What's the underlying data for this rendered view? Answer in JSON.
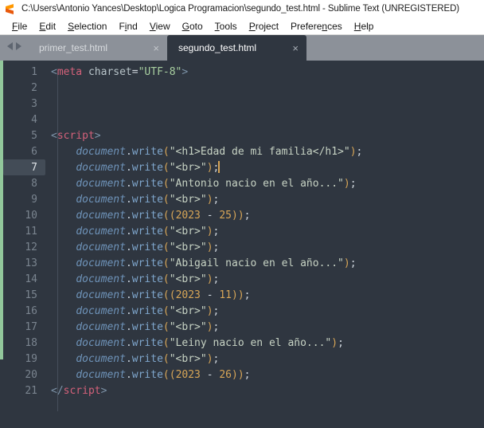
{
  "window": {
    "title": "C:\\Users\\Antonio Yances\\Desktop\\Logica Programacion\\segundo_test.html - Sublime Text (UNREGISTERED)",
    "icon": "sublime-text-icon"
  },
  "menubar": {
    "items": [
      {
        "label": "File",
        "accel": "F"
      },
      {
        "label": "Edit",
        "accel": "E"
      },
      {
        "label": "Selection",
        "accel": "S"
      },
      {
        "label": "Find",
        "accel": "i"
      },
      {
        "label": "View",
        "accel": "V"
      },
      {
        "label": "Goto",
        "accel": "G"
      },
      {
        "label": "Tools",
        "accel": "T"
      },
      {
        "label": "Project",
        "accel": "P"
      },
      {
        "label": "Preferences",
        "accel": "n"
      },
      {
        "label": "Help",
        "accel": "H"
      }
    ]
  },
  "tabbar": {
    "nav_prev_icon": "triangle-left-icon",
    "nav_next_icon": "triangle-right-icon",
    "tabs": [
      {
        "label": "primer_test.html",
        "active": false,
        "close_glyph": "×"
      },
      {
        "label": "segundo_test.html",
        "active": true,
        "close_glyph": "×"
      }
    ]
  },
  "editor": {
    "active_line": 7,
    "cursor_line": 7,
    "cursor_column": 31,
    "lines": [
      {
        "n": "1",
        "text": "<meta charset=\"UTF-8\">"
      },
      {
        "n": "2",
        "text": ""
      },
      {
        "n": "3",
        "text": ""
      },
      {
        "n": "4",
        "text": ""
      },
      {
        "n": "5",
        "text": "<script>"
      },
      {
        "n": "6",
        "text": "    document.write(\"<h1>Edad de mi familia</h1>\");"
      },
      {
        "n": "7",
        "text": "    document.write(\"<br>\");"
      },
      {
        "n": "8",
        "text": "    document.write(\"Antonio nacio en el año...\");"
      },
      {
        "n": "9",
        "text": "    document.write(\"<br>\");"
      },
      {
        "n": "10",
        "text": "    document.write((2023 - 25));"
      },
      {
        "n": "11",
        "text": "    document.write(\"<br>\");"
      },
      {
        "n": "12",
        "text": "    document.write(\"<br>\");"
      },
      {
        "n": "13",
        "text": "    document.write(\"Abigail nacio en el año...\");"
      },
      {
        "n": "14",
        "text": "    document.write(\"<br>\");"
      },
      {
        "n": "15",
        "text": "    document.write((2023 - 11));"
      },
      {
        "n": "16",
        "text": "    document.write(\"<br>\");"
      },
      {
        "n": "17",
        "text": "    document.write(\"<br>\");"
      },
      {
        "n": "18",
        "text": "    document.write(\"Leiny nacio en el año...\");"
      },
      {
        "n": "19",
        "text": "    document.write(\"<br>\");"
      },
      {
        "n": "20",
        "text": "    document.write((2023 - 26));"
      },
      {
        "n": "21",
        "text": "</script>"
      }
    ]
  },
  "colors": {
    "titlebar_bg": "#ffffff",
    "menubar_bg": "#ffffff",
    "tabbar_bg": "#8c9199",
    "editor_bg": "#2f3640",
    "active_line_gutter": "#434c57",
    "modified_strip": "#92c79b",
    "tag": "#d4617a",
    "string": "#c7d3c4",
    "number": "#d8a657",
    "variable": "#6f94ba",
    "function": "#7fa6cc",
    "cursor": "#d8a657"
  }
}
